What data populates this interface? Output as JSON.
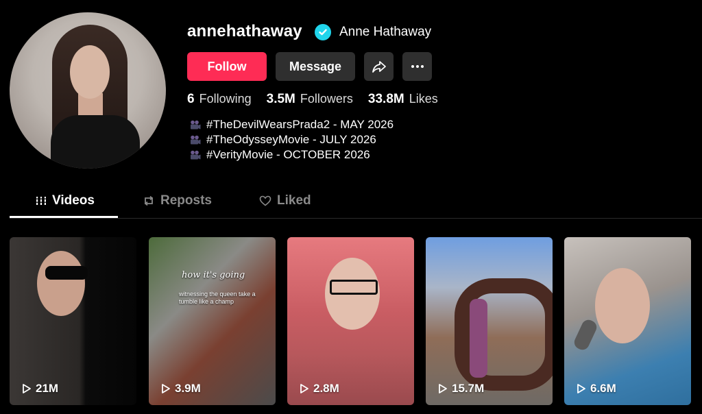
{
  "profile": {
    "username": "annehathaway",
    "display_name": "Anne Hathaway",
    "verified": true,
    "avatar_icon": "profile-photo"
  },
  "actions": {
    "follow_label": "Follow",
    "message_label": "Message",
    "share_icon": "share-icon",
    "more_icon": "more-icon"
  },
  "stats": {
    "following_count": "6",
    "following_label": "Following",
    "followers_count": "3.5M",
    "followers_label": "Followers",
    "likes_count": "33.8M",
    "likes_label": "Likes"
  },
  "bio": {
    "lines": [
      "#TheDevilWearsPrada2 - MAY 2026",
      "#TheOdysseyMovie - JULY 2026",
      "#VerityMovie - OCTOBER 2026"
    ]
  },
  "tabs": [
    {
      "label": "Videos",
      "icon": "grid-icon",
      "active": true
    },
    {
      "label": "Reposts",
      "icon": "repost-icon",
      "active": false
    },
    {
      "label": "Liked",
      "icon": "heart-icon",
      "active": false
    }
  ],
  "videos": [
    {
      "views": "21M"
    },
    {
      "views": "3.9M",
      "overlay_title": "how it's going",
      "overlay_caption": "witnessing the queen take a tumble like a champ"
    },
    {
      "views": "2.8M"
    },
    {
      "views": "15.7M"
    },
    {
      "views": "6.6M"
    }
  ],
  "colors": {
    "background": "#000000",
    "follow_button": "#fe2c55",
    "secondary_button": "#2f2f2f",
    "verified_badge": "#20d5ec",
    "muted_text": "#8a8a8a"
  }
}
